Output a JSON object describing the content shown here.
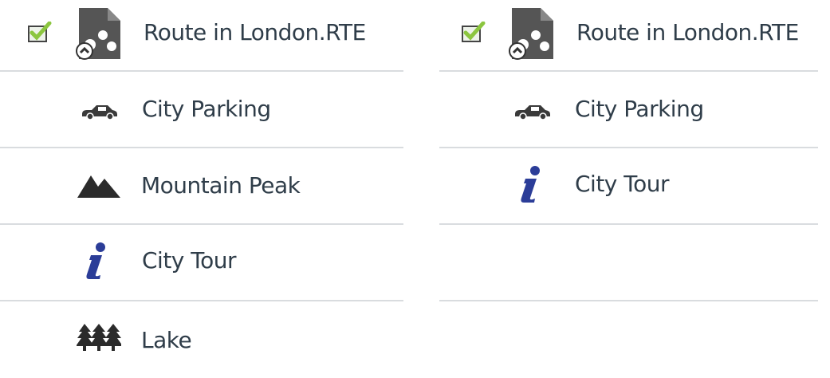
{
  "left_panel": {
    "header": {
      "checked": true,
      "file_icon": "route-file-icon",
      "title": "Route in London.RTE"
    },
    "items": [
      {
        "icon": "car-icon",
        "label": "City Parking"
      },
      {
        "icon": "mountain-icon",
        "label": "Mountain Peak"
      },
      {
        "icon": "info-icon",
        "label": "City Tour"
      },
      {
        "icon": "trees-icon",
        "label": "Lake"
      }
    ]
  },
  "right_panel": {
    "header": {
      "checked": true,
      "file_icon": "route-file-icon",
      "title": "Route in London.RTE"
    },
    "items": [
      {
        "icon": "car-icon",
        "label": "City Parking"
      },
      {
        "icon": "info-icon",
        "label": "City Tour"
      }
    ]
  },
  "colors": {
    "check_green": "#8cc63f",
    "icon_dark": "#3a3a3a",
    "info_blue": "#2b3d98",
    "divider": "#d9dcdf",
    "text": "#2f3d49"
  }
}
